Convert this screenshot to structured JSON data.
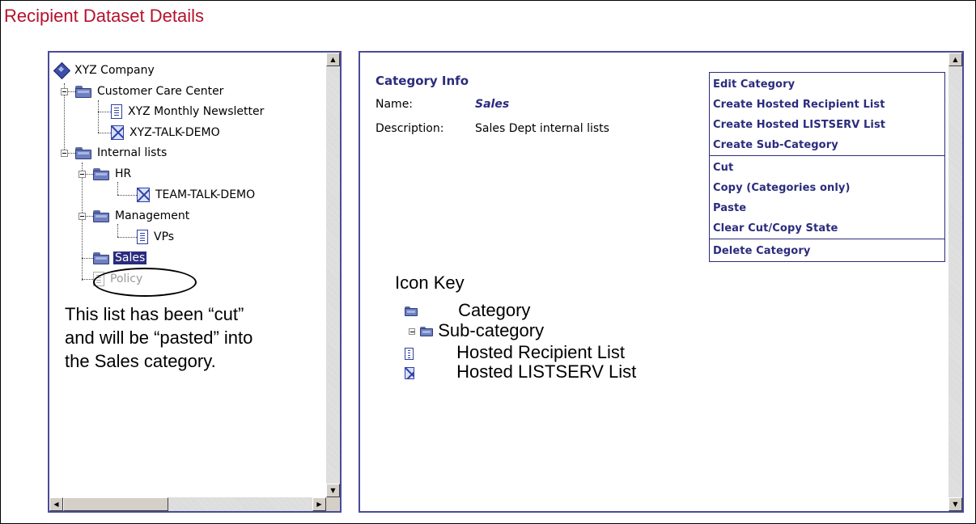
{
  "page_title": "Recipient Dataset Details",
  "tree": {
    "root": "XYZ Company",
    "customer_care": "Customer Care Center",
    "newsletter": "XYZ Monthly Newsletter",
    "talk_demo": "XYZ-TALK-DEMO",
    "internal": "Internal lists",
    "hr": "HR",
    "team_talk": "TEAM-TALK-DEMO",
    "management": "Management",
    "vps": "VPs",
    "sales": "Sales",
    "policy": "Policy"
  },
  "annotation": {
    "line1": "This list has been “cut”",
    "line2": "and will be “pasted” into",
    "line3": "the Sales category."
  },
  "category_info": {
    "heading": "Category Info",
    "name_label": "Name:",
    "name_value": "Sales",
    "desc_label": "Description:",
    "desc_value": "Sales Dept internal lists"
  },
  "actions": {
    "edit": "Edit Category",
    "create_hosted_recipient": "Create Hosted Recipient List",
    "create_hosted_listserv": "Create Hosted LISTSERV List",
    "create_sub": "Create Sub-Category",
    "cut": "Cut",
    "copy": "Copy (Categories only)",
    "paste": "Paste",
    "clear": "Clear Cut/Copy State",
    "delete": "Delete Category"
  },
  "icon_key": {
    "title": "Icon Key",
    "category": "Category",
    "sub_category": "Sub-category",
    "hosted_recipient": "Hosted Recipient List",
    "hosted_listserv": "Hosted LISTSERV List"
  },
  "colors": {
    "title_red": "#b5122b",
    "navy": "#2b2b7e",
    "panel_border": "#4a4a9a"
  },
  "icons": [
    "folder-icon",
    "document-icon",
    "listserv-icon",
    "company-icon",
    "scroll-arrow-icon"
  ]
}
